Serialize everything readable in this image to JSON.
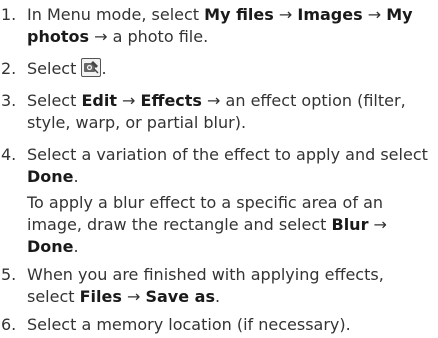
{
  "steps": [
    {
      "number": "1.",
      "lines": [
        [
          "In Menu mode, select ",
          {
            "b": "My files"
          },
          {
            "a": " → "
          },
          {
            "b": "Images"
          },
          {
            "a": " → "
          },
          {
            "b": "My"
          }
        ],
        [
          {
            "b": "photos"
          },
          {
            "a": " → "
          },
          "a photo file."
        ]
      ]
    },
    {
      "number": "2.",
      "lines": [
        [
          "Select ",
          {
            "icon": "photo-editor-icon"
          },
          "."
        ]
      ]
    },
    {
      "number": "3.",
      "lines": [
        [
          "Select ",
          {
            "b": "Edit"
          },
          {
            "a": " → "
          },
          {
            "b": "Effects"
          },
          {
            "a": " → "
          },
          "an effect option (filter,"
        ],
        [
          "style, warp, or partial blur)."
        ]
      ]
    },
    {
      "number": "4.",
      "lines": [
        [
          "Select a variation of the effect to apply and select"
        ],
        [
          {
            "b": "Done"
          },
          "."
        ]
      ],
      "note_lines": [
        [
          "To apply a blur effect to a specific area of an"
        ],
        [
          "image, draw the rectangle and select ",
          {
            "b": "Blur"
          },
          {
            "a": " →"
          }
        ],
        [
          {
            "b": "Done"
          },
          "."
        ]
      ]
    },
    {
      "number": "5.",
      "lines": [
        [
          "When you are finished with applying effects,"
        ],
        [
          "select ",
          {
            "b": "Files"
          },
          {
            "a": " → "
          },
          {
            "b": "Save as"
          },
          "."
        ]
      ]
    },
    {
      "number": "6.",
      "lines": [
        [
          "Select a memory location (if necessary)."
        ]
      ]
    }
  ],
  "colors": {
    "text": "#333333",
    "bold": "#1a1a1a",
    "icon_border": "#555555"
  }
}
